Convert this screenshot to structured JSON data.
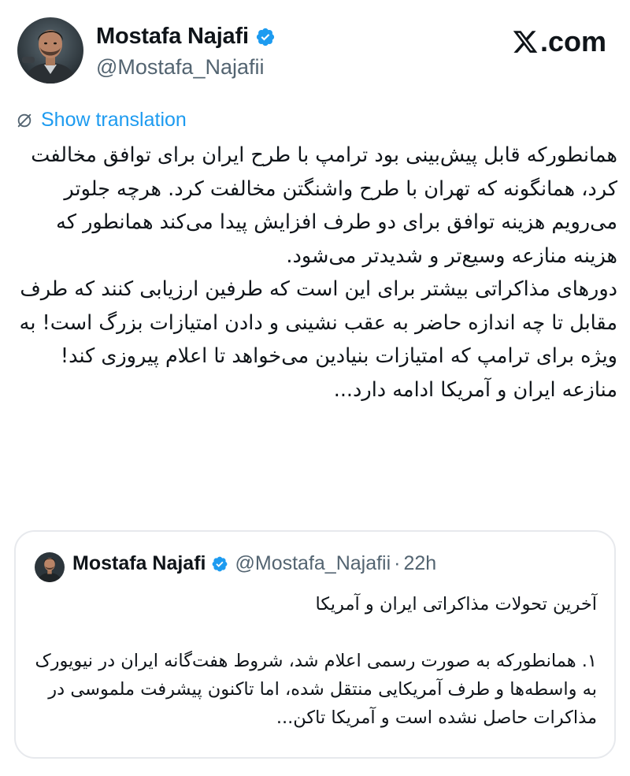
{
  "author": {
    "name": "Mostafa Najafi",
    "handle": "@Mostafa_Najafii",
    "verified_icon": "verified-badge-icon",
    "avatar_icon": "user-avatar"
  },
  "site": {
    "label": "𝕏.com",
    "text": ".com"
  },
  "translate": {
    "label": "Show translation",
    "icon": "globe-slash-icon",
    "color": "#1d9bf0"
  },
  "tweet": {
    "lines": [
      "همانطورکه قابل پیش‌بینی بود ترامپ با طرح ایران برای توافق مخالفت کرد، همانگونه که تهران با طرح واشنگتن مخالفت کرد. هرچه جلوتر می‌رویم هزینه توافق برای دو طرف افزایش پیدا می‌کند همانطور که هزینه منازعه وسیع‌تر و شدیدتر می‌شود.",
      "دورهای مذاکراتی بیشتر برای این است که طرفین ارزیابی کنند که طرف مقابل تا چه اندازه حاضر به عقب نشینی و دادن امتیازات بزرگ است! به ویژه برای ترامپ که امتیازات بنیادین می‌خواهد تا اعلام پیروزی کند!",
      "منازعه ایران و آمریکا ادامه دارد..."
    ]
  },
  "quoted": {
    "name": "Mostafa Najafi",
    "handle": "@Mostafa_Najafii",
    "separator": "·",
    "time": "22h",
    "headline": "آخرین تحولات مذاکراتی ایران و آمریکا",
    "body": "۱. همانطورکه به صورت رسمی اعلام شد، شروط هفت‌گانه ایران در نیویورک به واسطه‌ها و طرف آمریکایی منتقل شده، اما تاکنون پیشرفت ملموسی در مذاکرات حاصل نشده است و آمریکا تاکن..."
  },
  "colors": {
    "text": "#0f1419",
    "secondary": "#536471",
    "link": "#1d9bf0",
    "border": "#e7e9ed",
    "verified": "#1d9bf0"
  }
}
